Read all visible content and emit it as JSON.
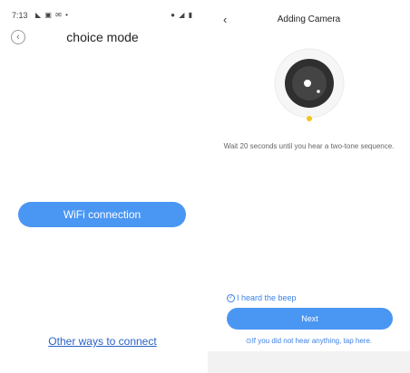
{
  "left_screen": {
    "status_bar": {
      "time": "7:13",
      "notif_icons": "◣ ▣ ✉ •",
      "system_icons": "● ◢ ▮"
    },
    "title": "choice mode",
    "wifi_button_label": "WiFi connection",
    "other_ways_link": "Other ways to connect"
  },
  "right_screen": {
    "title": "Adding Camera",
    "instruction": "Wait 20 seconds until you hear a two-tone sequence.",
    "heard_beep_label": "I heard the beep",
    "next_button_label": "Next",
    "help_text": "If you did not hear anything, tap here.",
    "help_icon_glyph": "⊙"
  },
  "colors": {
    "accent_blue": "#4a96f3",
    "link_blue": "#2a62c9",
    "indicator_yellow": "#f5c518"
  }
}
